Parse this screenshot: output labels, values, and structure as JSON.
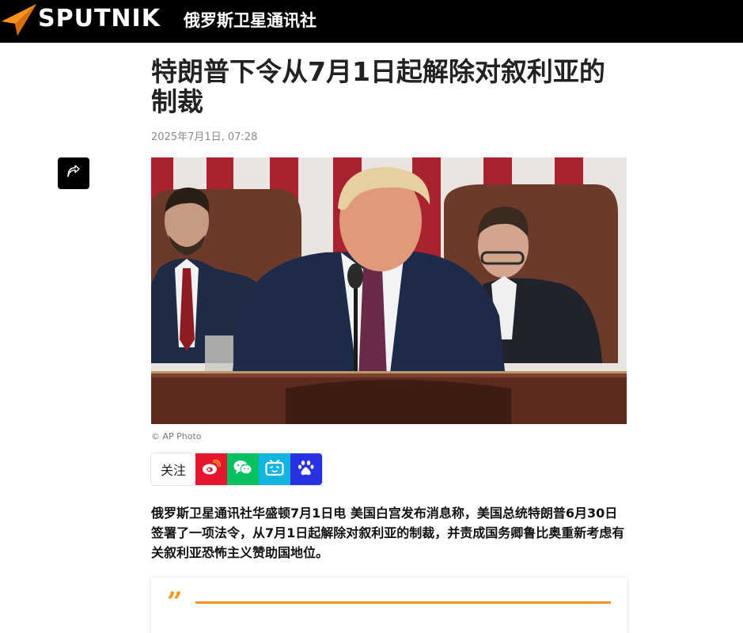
{
  "header": {
    "brand": "SPUTNIK",
    "site_name": "俄罗斯卫星通讯社",
    "brand_color": "#f7931e"
  },
  "article": {
    "title": "特朗普下令从7月1日起解除对叙利亚的制裁",
    "date": "2025年7月1日, 07:28",
    "photo_credit": "© AP Photo",
    "lead": "俄罗斯卫星通讯社华盛顿7月1日电 美国白宫发布消息称，美国总统特朗普6月30日签署了一项法令，从7月1日起解除对叙利亚的制裁，并责成国务卿鲁比奥重新考虑有关叙利亚恐怖主义赞助国地位。"
  },
  "social": {
    "follow_label": "关注",
    "buttons": [
      {
        "icon": "weibo-icon",
        "color": "#e6162d"
      },
      {
        "icon": "wechat-icon",
        "color": "#07c160"
      },
      {
        "icon": "bilibili-icon",
        "color": "#12b5e0"
      },
      {
        "icon": "baidu-icon",
        "color": "#2932e1"
      }
    ]
  },
  "quote": {
    "mark": "”",
    "accent": "#f7931e"
  }
}
